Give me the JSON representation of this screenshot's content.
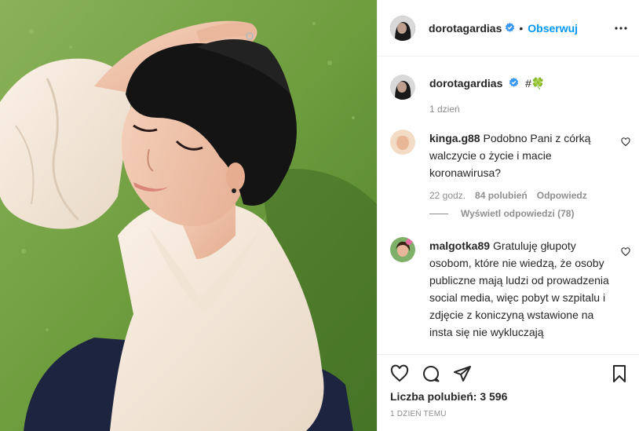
{
  "post_header": {
    "username": "dorotagardias",
    "separator": "•",
    "follow_label": "Obserwuj"
  },
  "caption": {
    "username": "dorotagardias",
    "text": "#🍀",
    "time": "1 dzień"
  },
  "comments": [
    {
      "username": "kinga.g88",
      "text": "Podobno Pani z córką walczycie o życie i macie koronawirusa?",
      "time": "22 godz.",
      "likes": "84 polubień",
      "reply_label": "Odpowiedz"
    },
    {
      "username": "malgotka89",
      "text": "Gratuluję głupoty osobom, które nie wiedzą, że osoby publiczne mają ludzi od prowadzenia social media, więc pobyt w szpitalu i zdjęcie z koniczyną wstawione na insta się nie wykluczają"
    }
  ],
  "view_replies_label": "Wyświetl odpowiedzi (78)",
  "footer": {
    "likes_text": "Liczba polubień: 3 596",
    "date_text": "1 DZIEŃ TEMU"
  },
  "icons": {
    "verified": "verified-badge-icon",
    "more": "more-options-icon",
    "like": "heart-icon",
    "comment": "comment-icon",
    "share": "paper-plane-icon",
    "save": "bookmark-icon"
  },
  "colors": {
    "accent": "#0095f6",
    "text": "#262626",
    "muted": "#8e8e8e",
    "divider": "#efefef",
    "verified": "#3897f0"
  }
}
